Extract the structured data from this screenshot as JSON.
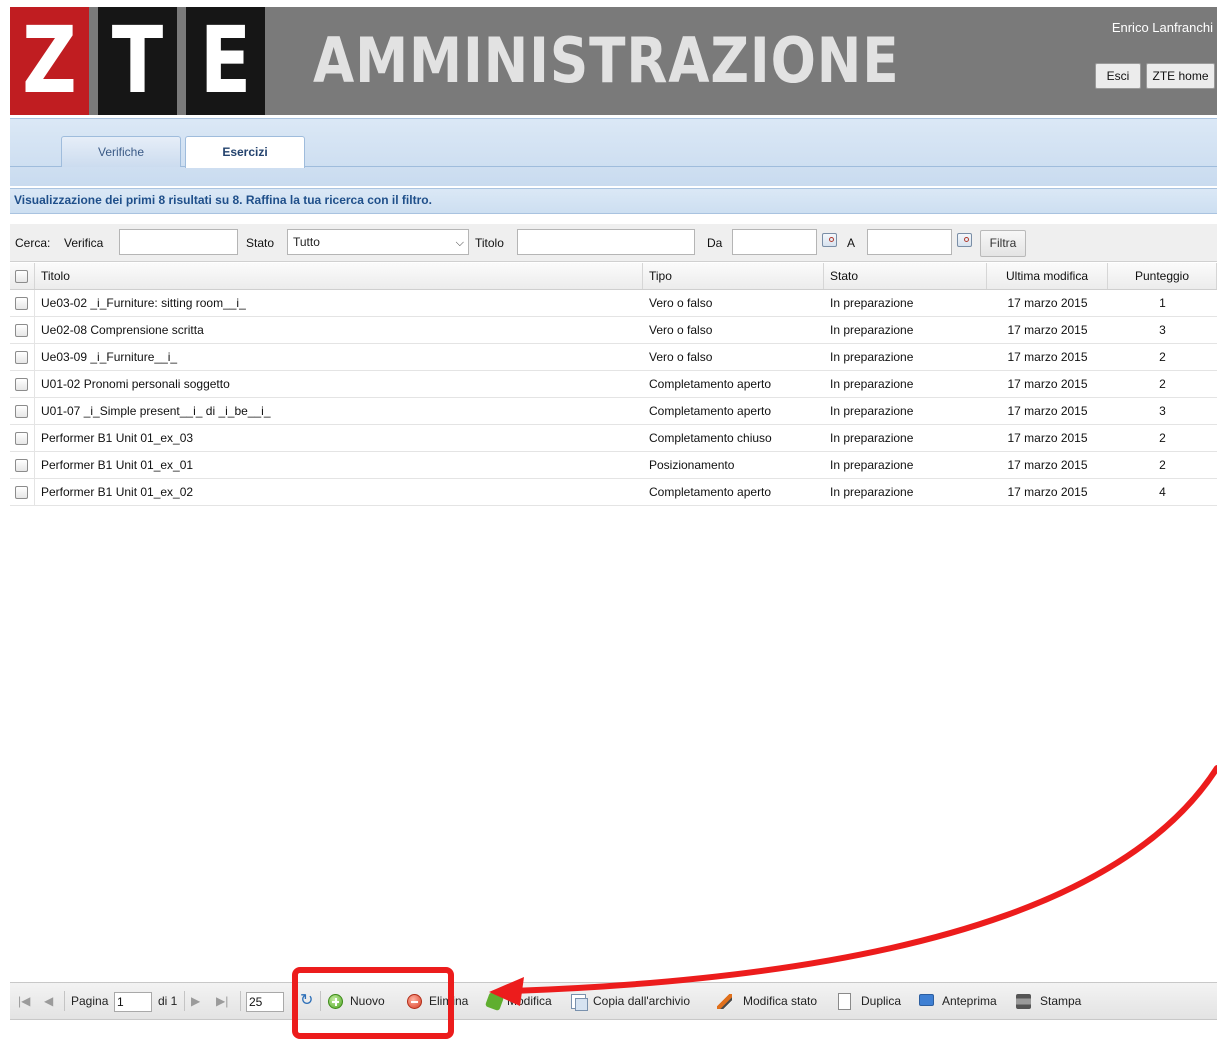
{
  "header": {
    "logo_letters": [
      "Z",
      "T",
      "E"
    ],
    "title": "AMMINISTRAZIONE",
    "user_name": "Enrico Lanfranchi",
    "buttons": {
      "logout": "Esci",
      "home": "ZTE home"
    },
    "colors": {
      "logo_red": "#c01d21",
      "logo_black": "#161616",
      "banner_gray": "#7a7a7a"
    }
  },
  "tabs": [
    {
      "label": "Verifiche",
      "active": false
    },
    {
      "label": "Esercizi",
      "active": true
    }
  ],
  "results_message": "Visualizzazione dei primi 8 risultati su 8. Raffina la tua ricerca con il filtro.",
  "filter": {
    "search_label": "Cerca:",
    "verifica_label": "Verifica",
    "verifica_value": "",
    "stato_label": "Stato",
    "stato_value": "Tutto",
    "titolo_label": "Titolo",
    "titolo_value": "",
    "da_label": "Da",
    "da_value": "",
    "a_label": "A",
    "a_value": "",
    "filter_button": "Filtra"
  },
  "grid": {
    "columns": [
      "Titolo",
      "Tipo",
      "Stato",
      "Ultima modifica",
      "Punteggio"
    ],
    "rows": [
      {
        "titolo": "Ue03-02 _i_Furniture: sitting room__i_",
        "tipo": "Vero o falso",
        "stato": "In preparazione",
        "data": "17 marzo 2015",
        "punteggio": "1"
      },
      {
        "titolo": "Ue02-08 Comprensione scritta",
        "tipo": "Vero o falso",
        "stato": "In preparazione",
        "data": "17 marzo 2015",
        "punteggio": "3"
      },
      {
        "titolo": "Ue03-09 _i_Furniture__i_",
        "tipo": "Vero o falso",
        "stato": "In preparazione",
        "data": "17 marzo 2015",
        "punteggio": "2"
      },
      {
        "titolo": "U01-02 Pronomi personali soggetto",
        "tipo": "Completamento aperto",
        "stato": "In preparazione",
        "data": "17 marzo 2015",
        "punteggio": "2"
      },
      {
        "titolo": "U01-07 _i_Simple present__i_ di _i_be__i_",
        "tipo": "Completamento aperto",
        "stato": "In preparazione",
        "data": "17 marzo 2015",
        "punteggio": "3"
      },
      {
        "titolo": "Performer B1 Unit 01_ex_03",
        "tipo": "Completamento chiuso",
        "stato": "In preparazione",
        "data": "17 marzo 2015",
        "punteggio": "2"
      },
      {
        "titolo": "Performer B1 Unit 01_ex_01",
        "tipo": "Posizionamento",
        "stato": "In preparazione",
        "data": "17 marzo 2015",
        "punteggio": "2"
      },
      {
        "titolo": "Performer B1 Unit 01_ex_02",
        "tipo": "Completamento aperto",
        "stato": "In preparazione",
        "data": "17 marzo 2015",
        "punteggio": "4"
      }
    ]
  },
  "toolbar": {
    "page_label": "Pagina",
    "page_value": "1",
    "of_label": "di 1",
    "page_size": "25",
    "buttons": {
      "new": "Nuovo",
      "delete": "Elimina",
      "edit": "Modifica",
      "copy_archive": "Copia dall'archivio",
      "change_status": "Modifica stato",
      "duplicate": "Duplica",
      "preview": "Anteprima",
      "print": "Stampa"
    }
  },
  "annotation": {
    "color": "#ec1c1c"
  }
}
